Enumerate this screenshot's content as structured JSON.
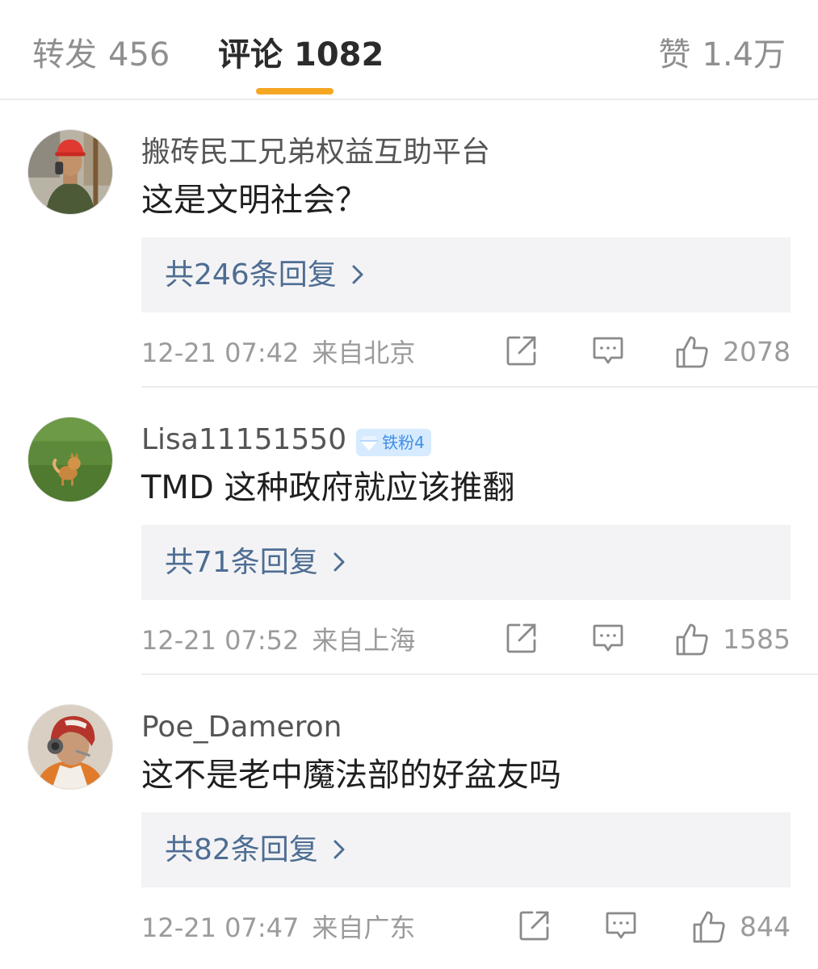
{
  "tabs": {
    "repost": {
      "label": "转发",
      "count": "456"
    },
    "comments": {
      "label": "评论",
      "count": "1082"
    },
    "likes": {
      "label": "赞",
      "count": "1.4万"
    }
  },
  "colors": {
    "accent_underline": "#f5a623",
    "reply_link": "#4e6d92",
    "badge_bg": "#d6ebff",
    "badge_text": "#3f8ee8"
  },
  "comments": [
    {
      "username": "搬砖民工兄弟权益互助平台",
      "badge": "",
      "text": "这是文明社会？",
      "replies": "共246条回复",
      "time": "12-21 07:42",
      "location": "来自北京",
      "likes": "2078",
      "avatar": "worker-photo"
    },
    {
      "username": "Lisa11151550",
      "badge": "铁粉4",
      "text": "TMD 这种政府就应该推翻",
      "replies": "共71条回复",
      "time": "12-21 07:52",
      "location": "来自上海",
      "likes": "1585",
      "avatar": "dog-on-grass-photo"
    },
    {
      "username": "Poe_Dameron",
      "badge": "",
      "text": "这不是老中魔法部的好盆友吗",
      "replies": "共82条回复",
      "time": "12-21 07:47",
      "location": "来自广东",
      "likes": "844",
      "avatar": "pilot-helmet-photo"
    }
  ]
}
